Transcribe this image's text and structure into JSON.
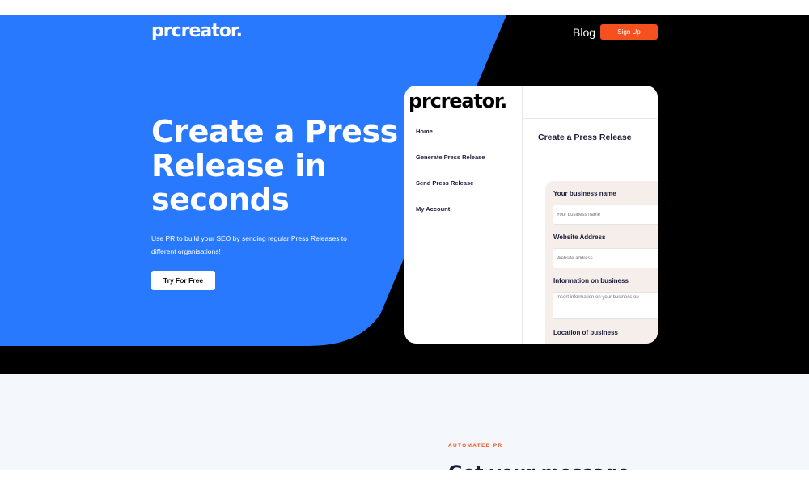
{
  "header": {
    "logo": "prcreator.",
    "nav_blog": "Blog",
    "signup_label": "Sign Up"
  },
  "hero": {
    "title": "Create a Press Release in seconds",
    "subtitle": "Use PR to build your SEO by sending regular Press Releases to different organisations!",
    "cta_label": "Try For Free"
  },
  "preview": {
    "logo": "prcreator.",
    "nav": [
      "Home",
      "Generate Press Release",
      "Send Press Release",
      "My Account"
    ],
    "title": "Create a Press Release",
    "form": {
      "business_name_label": "Your business name",
      "business_name_placeholder": "Your business name",
      "website_label": "Website Address",
      "website_placeholder": "Website address",
      "info_label": "Information on business",
      "info_placeholder": "Insert information on your business ou",
      "location_label": "Location of business"
    }
  },
  "section": {
    "eyebrow": "AUTOMATED PR",
    "title": "Get your message"
  },
  "colors": {
    "hero_blue": "#2979ff",
    "accent_orange": "#f4511e",
    "dark": "#000000",
    "text_navy": "#1b1b3a",
    "section_bg": "#f4f8fc"
  }
}
